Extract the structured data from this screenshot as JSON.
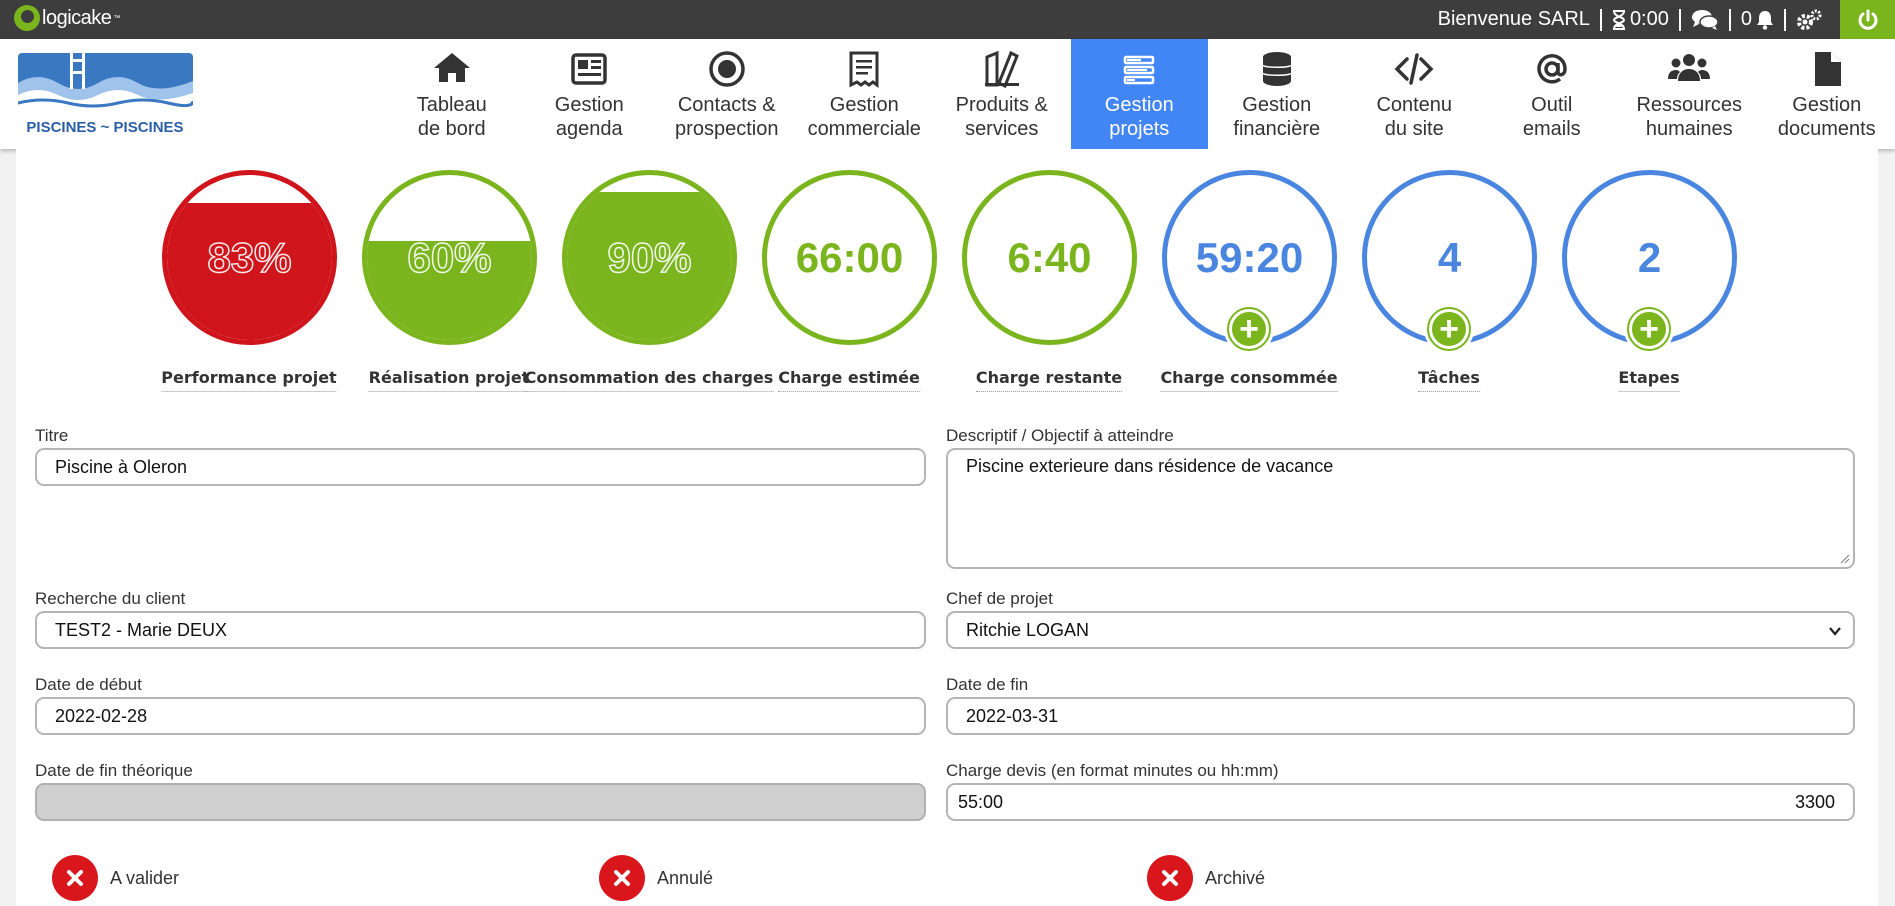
{
  "topbar": {
    "brand": "logicake",
    "welcome": "Bienvenue SARL",
    "timer": "0:00",
    "notifications": "0"
  },
  "logo": {
    "text": "PISCINES ~ PISCINES"
  },
  "nav": [
    {
      "label": "Tableau\nde bord",
      "icon": "home-icon"
    },
    {
      "label": "Gestion\nagenda",
      "icon": "newspaper-icon"
    },
    {
      "label": "Contacts &\nprospection",
      "icon": "bullseye-icon"
    },
    {
      "label": "Gestion\ncommerciale",
      "icon": "receipt-icon"
    },
    {
      "label": "Produits &\nservices",
      "icon": "tools-icon"
    },
    {
      "label": "Gestion\nprojets",
      "icon": "tasks-icon",
      "active": true
    },
    {
      "label": "Gestion\nfinancière",
      "icon": "coins-icon"
    },
    {
      "label": "Contenu\ndu site",
      "icon": "code-icon"
    },
    {
      "label": "Outil\nemails",
      "icon": "at-icon"
    },
    {
      "label": "Ressources\nhumaines",
      "icon": "users-icon"
    },
    {
      "label": "Gestion\ndocuments",
      "icon": "file-icon"
    }
  ],
  "gauges": [
    {
      "value": "83%",
      "label": "Performance projet",
      "fill": 0.83,
      "color": "#d0141b"
    },
    {
      "value": "60%",
      "label": "Réalisation projet",
      "fill": 0.6,
      "color": "#7ab51d"
    },
    {
      "value": "90%",
      "label": "Consommation des charges",
      "fill": 0.9,
      "color": "#7ab51d"
    },
    {
      "value": "66:00",
      "label": "Charge estimée",
      "color": "#7ab51d"
    },
    {
      "value": "6:40",
      "label": "Charge restante",
      "color": "#7ab51d"
    },
    {
      "value": "59:20",
      "label": "Charge consommée",
      "color": "#4a86e0",
      "plus": true
    },
    {
      "value": "4",
      "label": "Tâches",
      "color": "#4a86e0",
      "plus": true
    },
    {
      "value": "2",
      "label": "Etapes",
      "color": "#4a86e0",
      "plus": true
    }
  ],
  "form": {
    "titre_label": "Titre",
    "titre_value": "Piscine à Oleron",
    "descriptif_label": "Descriptif / Objectif à atteindre",
    "descriptif_value": "Piscine exterieure dans résidence de vacance",
    "client_label": "Recherche du client",
    "client_value": "TEST2 - Marie DEUX",
    "chef_label": "Chef de projet",
    "chef_value": "Ritchie LOGAN",
    "debut_label": "Date de début",
    "debut_value": "2022-02-28",
    "fin_label": "Date de fin",
    "fin_value": "2022-03-31",
    "fin_theo_label": "Date de fin théorique",
    "fin_theo_value": "",
    "charge_label": "Charge devis (en format minutes ou hh:mm)",
    "charge_value": "55:00",
    "charge_minutes": "3300"
  },
  "statuses": [
    {
      "label": "A valider"
    },
    {
      "label": "Annulé"
    },
    {
      "label": "Archivé"
    }
  ]
}
